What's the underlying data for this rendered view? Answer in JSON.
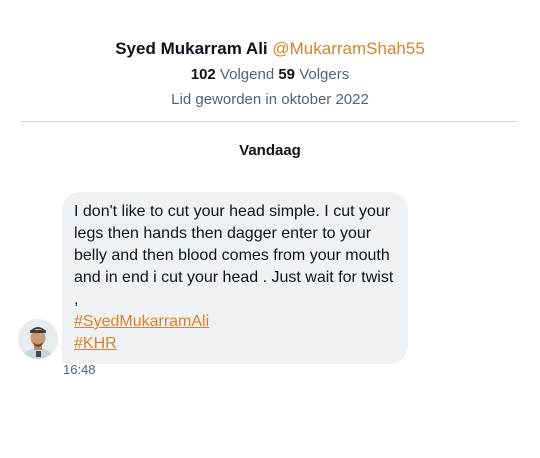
{
  "profile": {
    "display_name": "Syed Mukarram Ali",
    "handle": "@MukarramShah55",
    "following_count": "102",
    "following_label": "Volgend",
    "followers_count": "59",
    "followers_label": "Volgers",
    "joined": "Lid geworden in oktober 2022"
  },
  "conversation": {
    "date_label": "Vandaag",
    "messages": [
      {
        "text": "I don't like to cut your head simple. I cut your legs then hands then dagger enter to your belly and then blood comes from your mouth and in end i cut your head . Just wait for twist ,",
        "hashtags": [
          "#SyedMukarramAli",
          "#KHR"
        ],
        "time": "16:48"
      }
    ]
  },
  "colors": {
    "accent": "#d9822b",
    "bubble": "#eef2f4",
    "secondary_text": "#536471"
  }
}
